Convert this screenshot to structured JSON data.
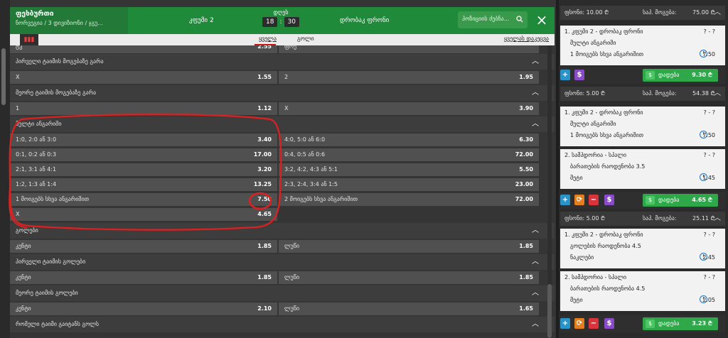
{
  "header": {
    "title": "ფეხბურთი",
    "subtitle": "ნორვეგია / 3 დივიზიონი / ჯგუ...",
    "team1": "კფუმი 2",
    "team2": "დრობაკ ფრონი",
    "date_label": "დღეს",
    "hour": "18",
    "minute": "30",
    "time_sep": ":",
    "search_placeholder": "პოზიციის ძებნა...",
    "close_icon": "×"
  },
  "tabs": {
    "stats_icon": "▮▮▮",
    "all": "ყველა",
    "goal": "გოლი",
    "collapse_all": "ყველას დაკეცვა"
  },
  "markets": {
    "top_partial": {
      "name": "ტკ",
      "val": "2.55",
      "name2": "ფრე",
      "val2": ""
    },
    "first_half_winner": {
      "title": "პირველი ტაიმის მოგებაზე გარა",
      "left": {
        "name": "X",
        "val": "1.55"
      },
      "right": {
        "name": "2",
        "val": "1.95"
      }
    },
    "second_half_winner": {
      "title": "მეორე ტაიმის მოგებაზე გარა",
      "left": {
        "name": "1",
        "val": "1.12"
      },
      "right": {
        "name": "X",
        "val": "3.90"
      }
    },
    "multi_score": {
      "title": "მულტი ანგარიში",
      "rows": [
        {
          "l": "1:0, 2:0 ან 3:0",
          "lv": "3.40",
          "r": "4:0, 5:0 ან 6:0",
          "rv": "6.30"
        },
        {
          "l": "0:1, 0:2 ან 0:3",
          "lv": "17.00",
          "r": "0:4, 0:5 ან 0:6",
          "rv": "72.00"
        },
        {
          "l": "2:1, 3:1 ან 4:1",
          "lv": "3.20",
          "r": "3:2, 4:2, 4:3 ან 5:1",
          "rv": "5.50"
        },
        {
          "l": "1:2, 1:3 ან 1:4",
          "lv": "13.25",
          "r": "2:3, 2:4, 3:4 ან 1:5",
          "rv": "23.00"
        },
        {
          "l": "1 მოიგებს სხვა ანგარიშით",
          "lv": "7.50",
          "r": "2 მოიგებს სხვა ანგარიშით",
          "rv": "72.00"
        },
        {
          "l": "X",
          "lv": "4.65",
          "r": "",
          "rv": ""
        }
      ]
    },
    "goals": {
      "title": "გოლები",
      "left": {
        "name": "კენტი",
        "val": "1.85"
      },
      "right": {
        "name": "ლუწი",
        "val": "1.85"
      }
    },
    "first_half_goals": {
      "title": "პირველი ტაიმის გოლები",
      "left": {
        "name": "კენტი",
        "val": "1.85"
      },
      "right": {
        "name": "ლუწი",
        "val": "1.85"
      }
    },
    "second_half_goals": {
      "title": "მეორე ტაიმის გოლები",
      "left": {
        "name": "კენტი",
        "val": "2.10"
      },
      "right": {
        "name": "ლუწი",
        "val": "1.65"
      }
    },
    "which_half_more": {
      "title": "რომელი ტაიმი გაიტანს გოლს"
    }
  },
  "betslip": {
    "cards": [
      {
        "stake": "ფსონი: 10.00 ₾",
        "possible": "საპ. მოგება:",
        "possible_val": "75.00 ₾",
        "selections": [
          {
            "match": "1. კფუმი 2 - დრობაკ ფრონი",
            "score": "? - ?",
            "market": "მულტი ანგარიში",
            "pick": "1 მოიგებს სხვა ანგარიშით",
            "odd": "7.50"
          }
        ],
        "place_label": "დადება",
        "place_amount": "9.30 ₾"
      },
      {
        "stake": "ფსონი: 5.00 ₾",
        "possible": "საპ. მოგება:",
        "possible_val": "54.38 ₾",
        "selections": [
          {
            "match": "1. კფუმი 2 - დრობაკ ფრონი",
            "score": "? - ?",
            "market": "მულტი ანგარიში",
            "pick": "1 მოიგებს სხვა ანგარიშით",
            "odd": "7.50"
          },
          {
            "match": "2. სამპდორია - სპალი",
            "score": "? - ?",
            "market": "ბარათების რაოდენობა 3.5",
            "pick": "მეტი",
            "odd": "1.45"
          }
        ],
        "place_label": "დადება",
        "place_amount": "4.65 ₾"
      },
      {
        "stake": "ფსონი: 5.00 ₾",
        "possible": "საპ. მოგება:",
        "possible_val": "25.11 ₾",
        "selections": [
          {
            "match": "1. კფუმი 2 - დრობაკ ფრონი",
            "score": "? - ?",
            "market": "გოლების რაოდენობა 4.5",
            "pick": "ნაკლები",
            "odd": "2.45"
          },
          {
            "match": "2. სამპდორია - სპალი",
            "score": "? - ?",
            "market": "ბარათების რაოდენობა 4.5",
            "pick": "მეტი",
            "odd": "2.05"
          }
        ],
        "place_label": "დადება",
        "place_amount": "3.23 ₾"
      }
    ]
  },
  "colors": {
    "header_green": "#1f8a3a",
    "place_green": "#2fa84a",
    "annotation_red": "#e02020"
  }
}
